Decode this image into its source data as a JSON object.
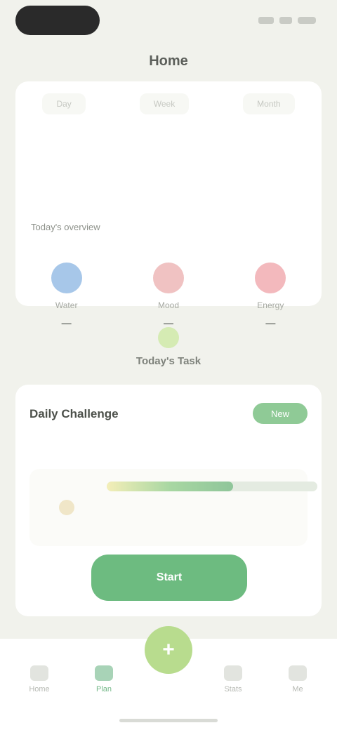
{
  "page": {
    "title": "Home"
  },
  "hero": {
    "tabs": [
      "Day",
      "Week",
      "Month"
    ],
    "caption_text": "Today's overview",
    "caption_accent": "",
    "stats": [
      {
        "icon": "water-drop-icon",
        "color": "#a7c7e9",
        "label": "Water",
        "value": "—"
      },
      {
        "icon": "heart-icon",
        "color": "#f0c2c2",
        "label": "Mood",
        "value": "—"
      },
      {
        "icon": "flame-icon",
        "color": "#f3b9bd",
        "label": "Energy",
        "value": "—"
      }
    ]
  },
  "section": {
    "title": "Today's Task"
  },
  "task": {
    "title": "Daily Challenge",
    "badge": "New",
    "subtitle": "",
    "progress": 0.6,
    "line1": "",
    "line2": "",
    "button_label": "Start"
  },
  "tabbar": {
    "items": [
      {
        "label": "Home",
        "active": false
      },
      {
        "label": "Plan",
        "active": true
      },
      {
        "label": "Stats",
        "active": false
      },
      {
        "label": "Me",
        "active": false
      }
    ],
    "fab_symbol": "+"
  },
  "colors": {
    "accent": "#6dbb80",
    "background": "#f1f2ec"
  }
}
